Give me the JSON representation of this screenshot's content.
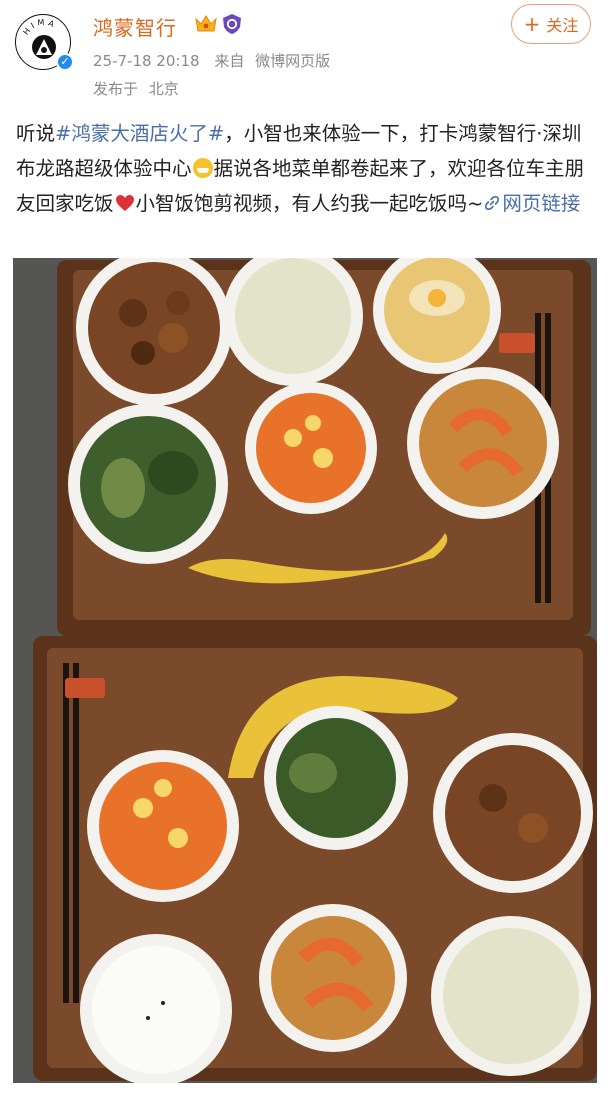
{
  "account": {
    "name": "鸿蒙智行",
    "avatar_text": "HIMA",
    "follow_label": "关注",
    "follow_icon": "plus-icon"
  },
  "meta": {
    "date": "25-7-18 20:18",
    "source_prefix": "来自",
    "source": "微博网页版",
    "location_prefix": "发布于",
    "location": "北京"
  },
  "post": {
    "text_1": "听说",
    "hashtag": "#鸿蒙大酒店火了#",
    "text_2": "，小智也来体验一下，打卡鸿蒙智行·深圳布龙路超级体验中心",
    "text_3": "据说各地菜单都卷起来了，欢迎各位车主朋友回家吃饭",
    "text_4": "小智饭饱剪视频，有人约我一起吃饭吗~",
    "link_label": "网页链接",
    "emoji_1": "grin-emoji",
    "emoji_2": "red-heart-emoji"
  },
  "colors": {
    "brand": "#e0661c",
    "link": "#4a6ea8",
    "meta": "#8a8a8a",
    "tray": "#6e3f22"
  }
}
